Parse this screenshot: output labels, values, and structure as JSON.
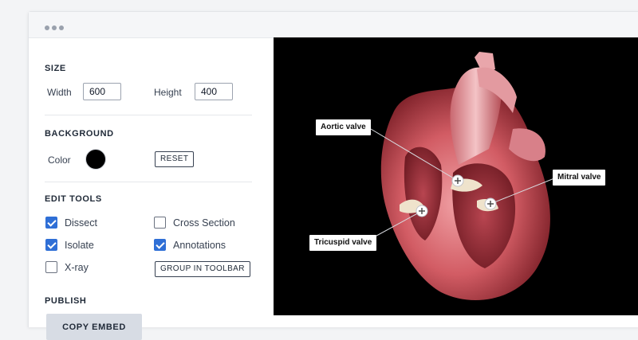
{
  "size": {
    "title": "SIZE",
    "width_label": "Width",
    "width_value": "600",
    "height_label": "Height",
    "height_value": "400"
  },
  "background": {
    "title": "BACKGROUND",
    "color_label": "Color",
    "color_value": "#000000",
    "reset_label": "RESET"
  },
  "edit_tools": {
    "title": "EDIT TOOLS",
    "options": [
      {
        "label": "Dissect",
        "checked": true
      },
      {
        "label": "Cross Section",
        "checked": false
      },
      {
        "label": "Isolate",
        "checked": true
      },
      {
        "label": "Annotations",
        "checked": true
      },
      {
        "label": "X-ray",
        "checked": false
      }
    ],
    "group_label": "GROUP IN TOOLBAR"
  },
  "publish": {
    "title": "PUBLISH",
    "copy_label": "COPY EMBED"
  },
  "viewer": {
    "annotations": [
      {
        "label": "Aortic valve"
      },
      {
        "label": "Mitral valve"
      },
      {
        "label": "Tricuspid valve"
      }
    ]
  },
  "colors": {
    "accent": "#2f6fd6",
    "viewer_background": "#000000"
  }
}
